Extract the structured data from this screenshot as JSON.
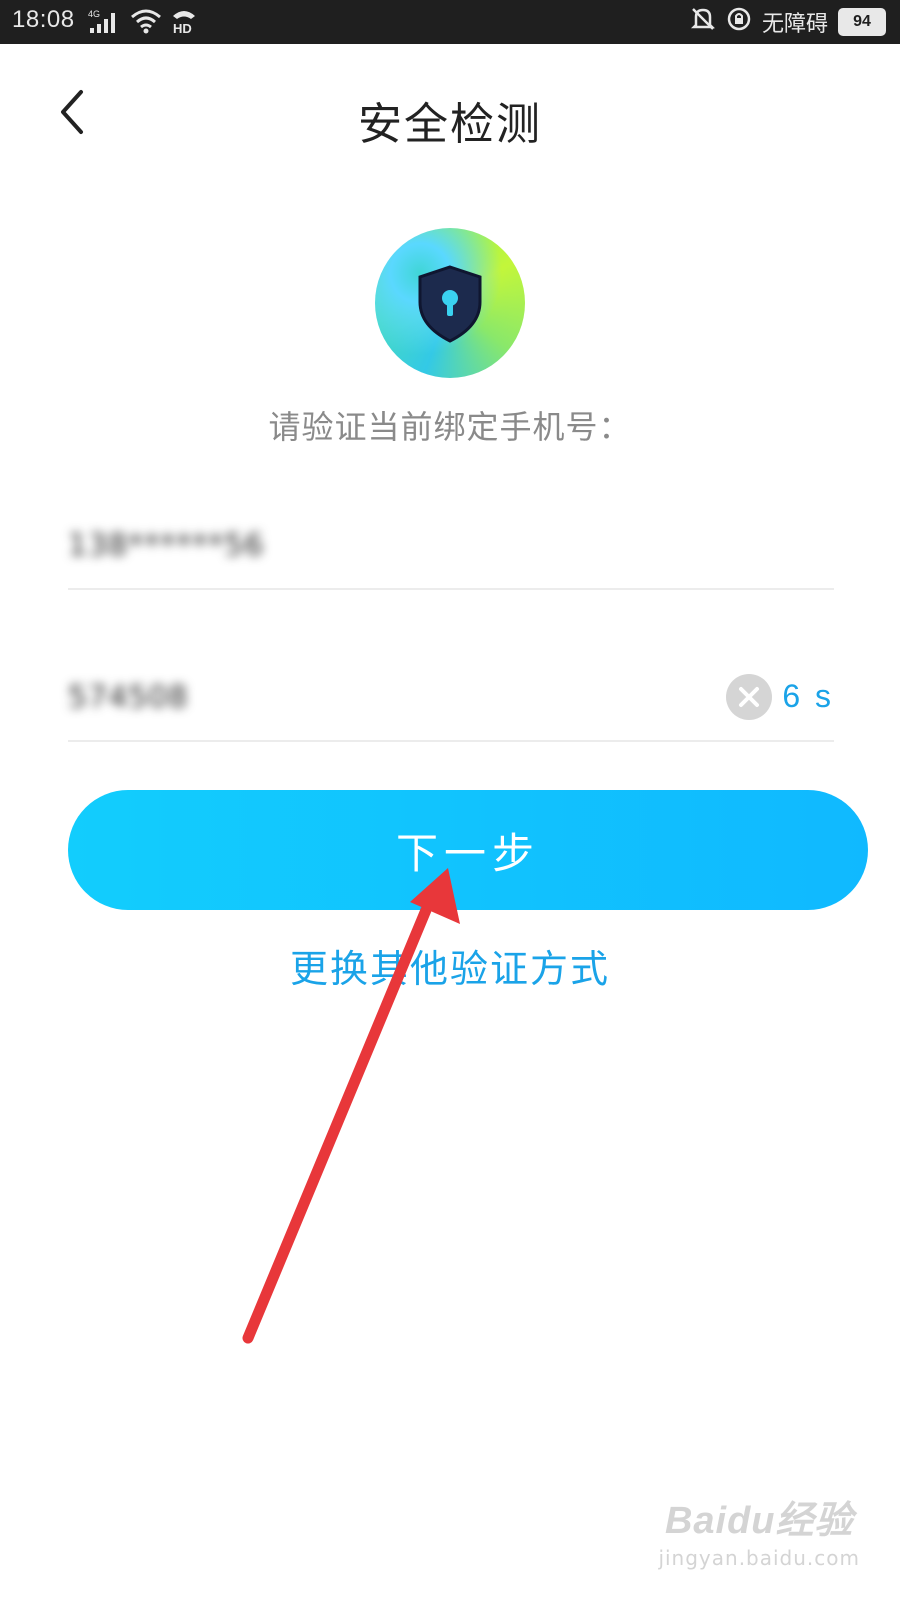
{
  "status_bar": {
    "time": "18:08",
    "network": "4G",
    "accessibility_label": "无障碍",
    "battery": "94"
  },
  "header": {
    "title": "安全检测"
  },
  "main": {
    "hint": "请验证当前绑定手机号：",
    "phone_value": "138******56",
    "code_value": "574508",
    "countdown": "6 s",
    "next_button_label": "下一步",
    "alt_link_label": "更换其他验证方式"
  },
  "watermark": {
    "brand": "Baidu经验",
    "url": "jingyan.baidu.com"
  },
  "colors": {
    "accent": "#1aa3e8",
    "button": "#12cdfd",
    "annotation_arrow": "#e8373a"
  }
}
